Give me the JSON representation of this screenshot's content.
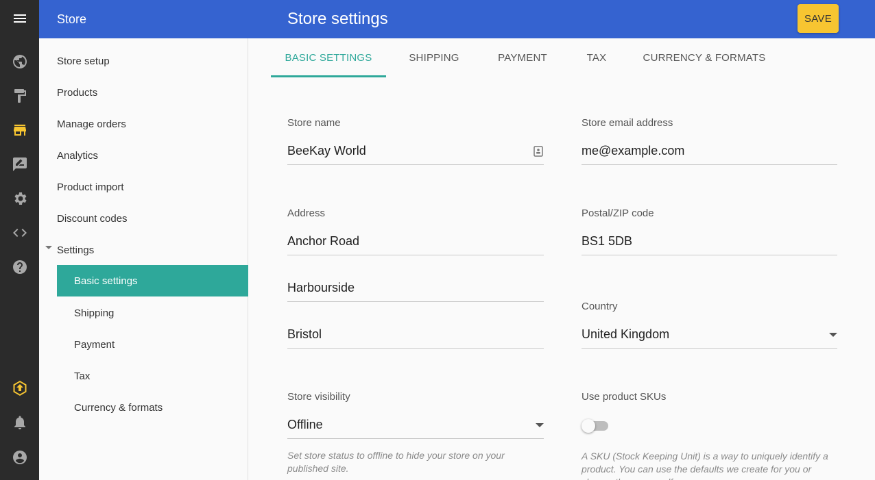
{
  "rail": {
    "icons": [
      "menu-icon",
      "globe-icon",
      "paint-roller-icon",
      "store-icon",
      "feedback-icon",
      "gear-icon",
      "code-icon",
      "help-icon",
      "upgrade-icon",
      "bell-icon",
      "account-icon"
    ],
    "active": "store-icon",
    "accent_color": "#f7c531"
  },
  "header": {
    "app_title": "Store",
    "page_title": "Store settings",
    "save_label": "SAVE",
    "bg_color": "#3563d0",
    "save_color": "#f7c531"
  },
  "sidebar": {
    "items": [
      {
        "label": "Store setup"
      },
      {
        "label": "Products"
      },
      {
        "label": "Manage orders"
      },
      {
        "label": "Analytics"
      },
      {
        "label": "Product import"
      },
      {
        "label": "Discount codes"
      },
      {
        "label": "Settings"
      }
    ],
    "sub_items": [
      {
        "label": "Basic settings",
        "selected": true
      },
      {
        "label": "Shipping"
      },
      {
        "label": "Payment"
      },
      {
        "label": "Tax"
      },
      {
        "label": "Currency & formats"
      }
    ],
    "selected_color": "#2ea89a"
  },
  "tabs": [
    {
      "label": "BASIC SETTINGS",
      "active": true
    },
    {
      "label": "SHIPPING"
    },
    {
      "label": "PAYMENT"
    },
    {
      "label": "TAX"
    },
    {
      "label": "CURRENCY & FORMATS"
    }
  ],
  "form": {
    "store_name": {
      "label": "Store name",
      "value": "BeeKay World"
    },
    "store_email": {
      "label": "Store email address",
      "value": "me@example.com"
    },
    "address": {
      "label": "Address",
      "line1": "Anchor Road",
      "line2": "Harbourside",
      "line3": "Bristol"
    },
    "postal": {
      "label": "Postal/ZIP code",
      "value": "BS1 5DB"
    },
    "country": {
      "label": "Country",
      "value": "United Kingdom"
    },
    "visibility": {
      "label": "Store visibility",
      "value": "Offline",
      "helper": "Set store status to offline to hide your store on your published site."
    },
    "skus": {
      "label": "Use product SKUs",
      "enabled": false,
      "helper": "A SKU (Stock Keeping Unit) is a way to uniquely identify a product. You can use the defaults we create for you or choose them yourself."
    }
  }
}
